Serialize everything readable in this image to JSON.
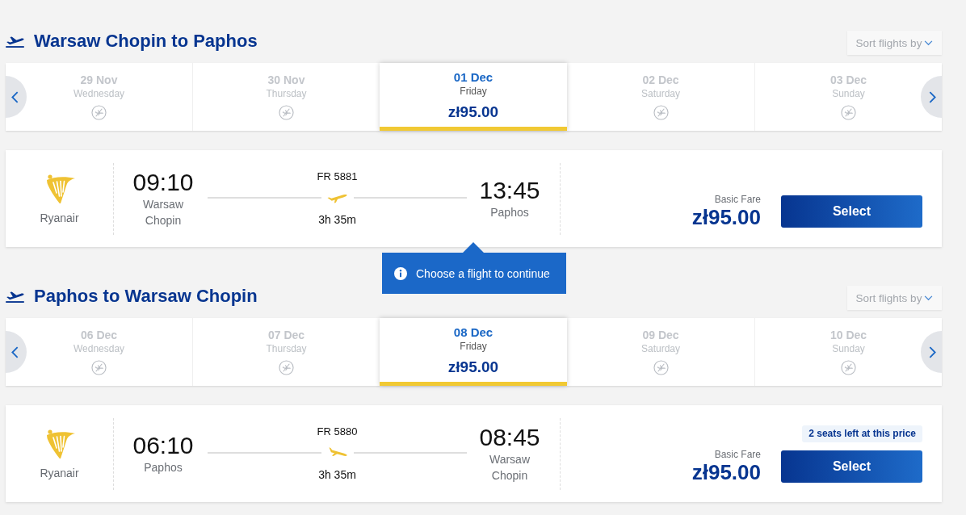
{
  "journeys": [
    {
      "kind": "outbound",
      "title": "Warsaw Chopin to Paphos",
      "sort_button": "Sort flights by",
      "dates": [
        {
          "date": "29 Nov",
          "weekday": "Wednesday",
          "available": false,
          "selected": false
        },
        {
          "date": "30 Nov",
          "weekday": "Thursday",
          "available": false,
          "selected": false
        },
        {
          "date": "01 Dec",
          "weekday": "Friday",
          "price": "zł95.00",
          "available": true,
          "selected": true
        },
        {
          "date": "02 Dec",
          "weekday": "Saturday",
          "available": false,
          "selected": false
        },
        {
          "date": "03 Dec",
          "weekday": "Sunday",
          "available": false,
          "selected": false
        }
      ],
      "flight": {
        "airline": "Ryanair",
        "departure_time": "09:10",
        "departure_airport": "Warsaw Chopin",
        "flight_number": "FR 5881",
        "duration": "3h 35m",
        "arrival_time": "13:45",
        "arrival_airport": "Paphos",
        "fare_label": "Basic Fare",
        "price": "zł95.00",
        "button": "Select"
      }
    },
    {
      "kind": "return",
      "title": "Paphos to Warsaw Chopin",
      "sort_button": "Sort flights by",
      "dates": [
        {
          "date": "06 Dec",
          "weekday": "Wednesday",
          "available": false,
          "selected": false
        },
        {
          "date": "07 Dec",
          "weekday": "Thursday",
          "available": false,
          "selected": false
        },
        {
          "date": "08 Dec",
          "weekday": "Friday",
          "price": "zł95.00",
          "available": true,
          "selected": true
        },
        {
          "date": "09 Dec",
          "weekday": "Saturday",
          "available": false,
          "selected": false
        },
        {
          "date": "10 Dec",
          "weekday": "Sunday",
          "available": false,
          "selected": false
        }
      ],
      "flight": {
        "airline": "Ryanair",
        "departure_time": "06:10",
        "departure_airport": "Paphos",
        "flight_number": "FR 5880",
        "duration": "3h 35m",
        "arrival_time": "08:45",
        "arrival_airport": "Warsaw Chopin",
        "seats_notice": "2 seats left at this price",
        "fare_label": "Basic Fare",
        "price": "zł95.00",
        "button": "Select"
      }
    }
  ],
  "tooltip": {
    "text": "Choose a flight to continue"
  }
}
